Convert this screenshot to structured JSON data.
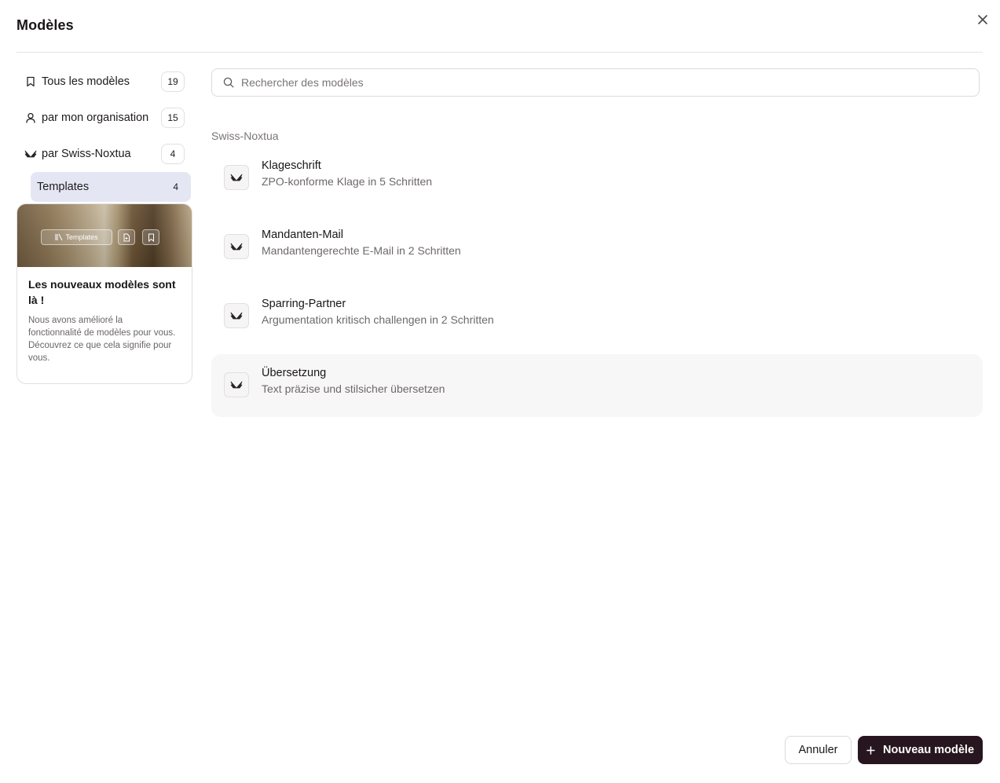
{
  "dialog": {
    "title": "Modèles"
  },
  "sidebar": {
    "items": [
      {
        "label": "Tous les modèles",
        "count": "19",
        "icon": "bookmark-icon"
      },
      {
        "label": "par mon organisation",
        "count": "15",
        "icon": "user-icon"
      },
      {
        "label": "par Swiss-Noxtua",
        "count": "4",
        "icon": "wings-logo-icon"
      }
    ],
    "subitem": {
      "label": "Templates",
      "count": "4"
    }
  },
  "promo": {
    "chip_label": "Templates",
    "title": "Les nouveaux modèles sont là !",
    "description": "Nous avons amélioré la fonctionnalité de modèles pour vous. Découvrez ce que cela signifie pour vous."
  },
  "search": {
    "placeholder": "Rechercher des modèles",
    "value": ""
  },
  "section": {
    "label": "Swiss-Noxtua"
  },
  "templates": [
    {
      "name": "Klageschrift",
      "description": "ZPO-konforme Klage in 5 Schritten"
    },
    {
      "name": "Mandanten-Mail",
      "description": "Mandantengerechte E-Mail in 2 Schritten"
    },
    {
      "name": "Sparring-Partner",
      "description": "Argumentation kritisch challengen in 2 Schritten"
    },
    {
      "name": "Übersetzung",
      "description": "Text präzise und stilsicher übersetzen"
    }
  ],
  "footer": {
    "cancel_label": "Annuler",
    "new_label": "Nouveau modèle"
  },
  "colors": {
    "primary_button": "#27161f",
    "selected_nav": "#e4e7f3",
    "hover_row": "#f8f7f7"
  }
}
